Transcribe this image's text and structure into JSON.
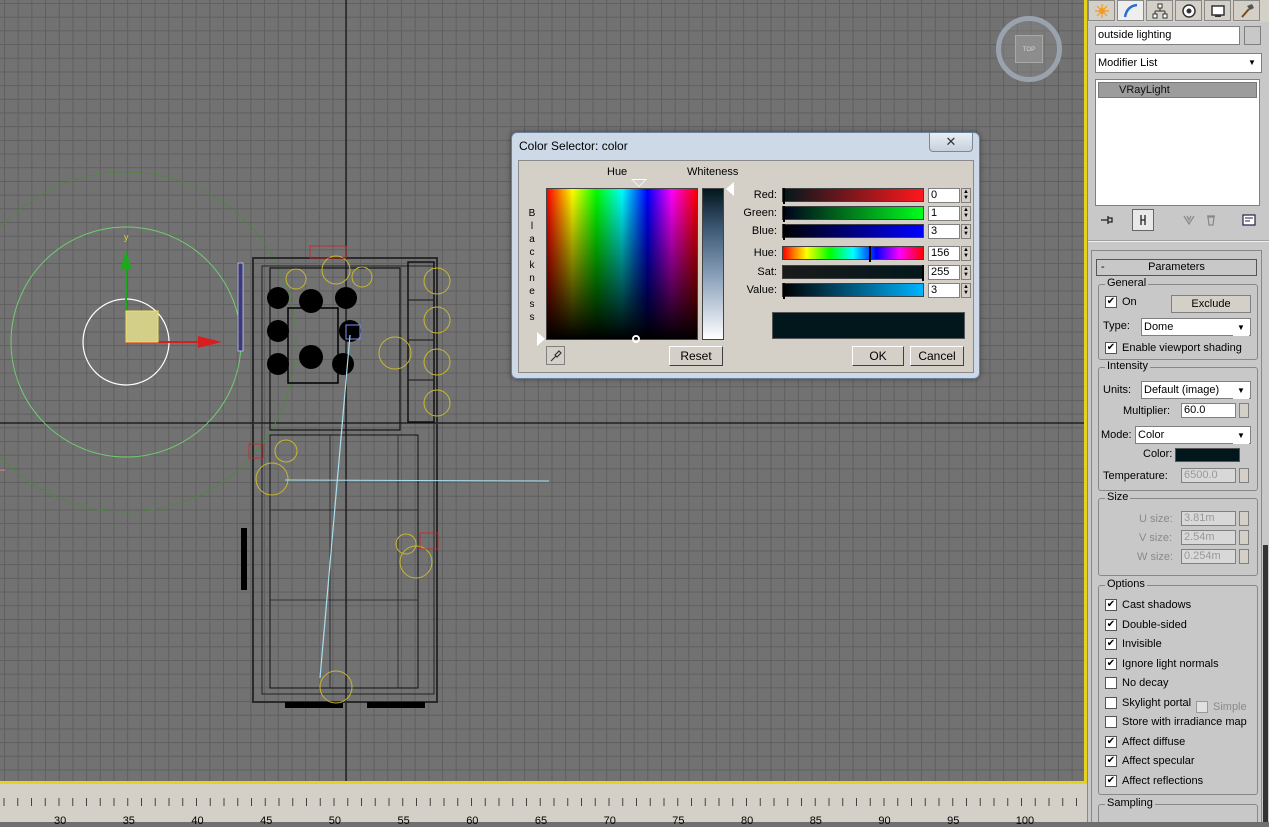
{
  "viewport": {
    "viewcube_label": "TOP",
    "border_color": "#e8d21d",
    "ruler": [
      "30",
      "35",
      "40",
      "45",
      "50",
      "55",
      "60",
      "65",
      "70",
      "75",
      "80",
      "85",
      "90",
      "95",
      "100"
    ]
  },
  "dialog": {
    "title": "Color Selector: color",
    "close_glyph": "✕",
    "hue_label": "Hue",
    "whiteness_label": "Whiteness",
    "blackness_label": "B l a c k n e s s",
    "reset": "Reset",
    "ok": "OK",
    "cancel": "Cancel",
    "preview_color": "#02171c",
    "sliders": {
      "red": {
        "label": "Red:",
        "value": "0"
      },
      "green": {
        "label": "Green:",
        "value": "1"
      },
      "blue": {
        "label": "Blue:",
        "value": "3"
      },
      "hue": {
        "label": "Hue:",
        "value": "156"
      },
      "sat": {
        "label": "Sat:",
        "value": "255"
      },
      "val": {
        "label": "Value:",
        "value": "3"
      }
    }
  },
  "panel": {
    "object_name": "outside lighting",
    "modifier_list": "Modifier List",
    "stack_item": "VRayLight",
    "params_title": "Parameters",
    "params_toggle": "-",
    "general": {
      "title": "General",
      "on_label": "On",
      "exclude": "Exclude",
      "type_label": "Type:",
      "type_value": "Dome",
      "viewport_shading": "Enable viewport shading"
    },
    "intensity": {
      "title": "Intensity",
      "units_label": "Units:",
      "units_value": "Default (image)",
      "multiplier_label": "Multiplier:",
      "multiplier_value": "60.0",
      "mode_label": "Mode:",
      "mode_value": "Color",
      "color_label": "Color:",
      "color_value": "#02171c",
      "temperature_label": "Temperature:",
      "temperature_value": "6500.0"
    },
    "size": {
      "title": "Size",
      "u_label": "U size:",
      "u_value": "3.81m",
      "v_label": "V size:",
      "v_value": "2.54m",
      "w_label": "W size:",
      "w_value": "0.254m"
    },
    "options": {
      "title": "Options",
      "items": [
        {
          "label": "Cast shadows",
          "checked": true
        },
        {
          "label": "Double-sided",
          "checked": true
        },
        {
          "label": "Invisible",
          "checked": true
        },
        {
          "label": "Ignore light normals",
          "checked": true
        },
        {
          "label": "No decay",
          "checked": false
        },
        {
          "label": "Skylight portal",
          "checked": false
        },
        {
          "label": "Store with irradiance map",
          "checked": false
        },
        {
          "label": "Affect diffuse",
          "checked": true
        },
        {
          "label": "Affect specular",
          "checked": true
        },
        {
          "label": "Affect reflections",
          "checked": true
        }
      ],
      "simple_label": "Simple"
    },
    "sampling": {
      "title": "Sampling"
    }
  }
}
